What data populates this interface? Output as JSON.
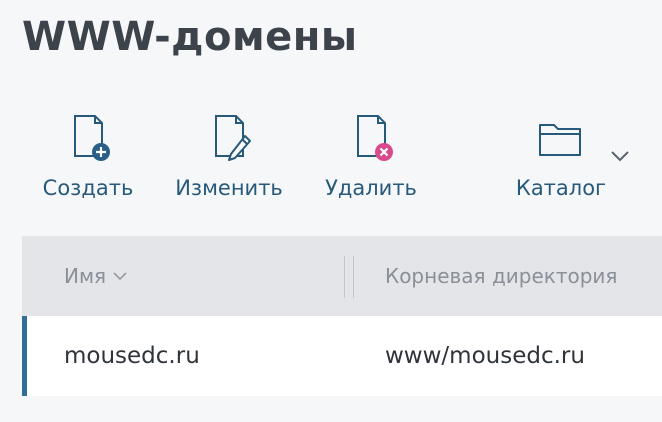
{
  "header": {
    "title": "WWW-домены"
  },
  "toolbar": {
    "create_label": "Создать",
    "edit_label": "Изменить",
    "delete_label": "Удалить",
    "catalog_label": "Каталог"
  },
  "icons": {
    "create": "new-document-plus-icon",
    "edit": "document-pencil-icon",
    "delete": "document-delete-icon",
    "catalog": "folder-icon",
    "more": "chevron-down-icon",
    "sort": "chevron-down-icon"
  },
  "colors": {
    "accent": "#2e6e99",
    "label": "#27597a",
    "create_badge": "#2a5f86",
    "delete_badge": "#d9498c"
  },
  "table": {
    "columns": [
      "Имя",
      "Корневая директория"
    ],
    "rows": [
      {
        "name": "mousedc.ru",
        "root": "www/mousedc.ru"
      }
    ]
  }
}
